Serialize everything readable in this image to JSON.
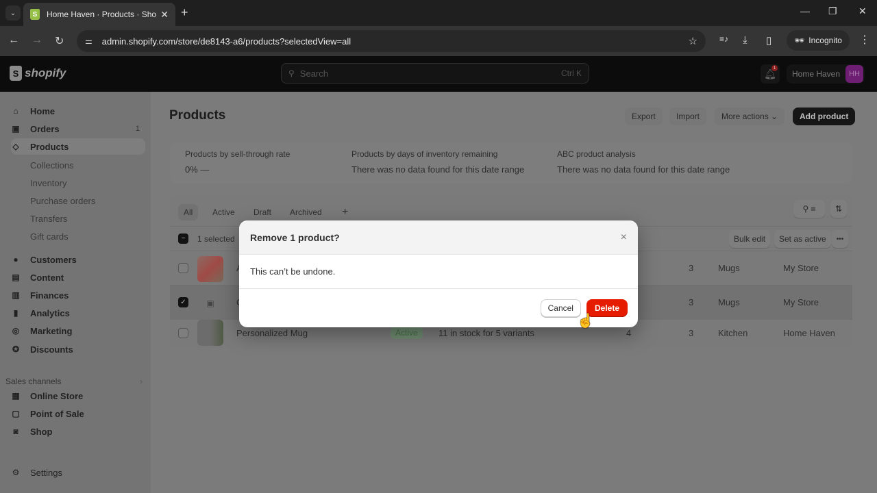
{
  "browser": {
    "tab_title": "Home Haven · Products · Shopify",
    "url": "admin.shopify.com/store/de8143-a6/products?selectedView=all",
    "incognito_label": "Incognito",
    "new_tab": "+",
    "icons": {
      "back": "←",
      "forward": "→",
      "reload": "↻",
      "star": "☆",
      "media": "≡♪",
      "download": "⤓",
      "sidepanel": "▯",
      "menu": "⋮",
      "minimize": "—",
      "restore": "❐",
      "close": "✕",
      "tab_close": "✕",
      "tabs_menu": "⌄"
    }
  },
  "topbar": {
    "logo_text": "shopify",
    "search_placeholder": "Search",
    "search_shortcut": "Ctrl K",
    "notification_count": "1",
    "store_name": "Home Haven",
    "avatar_initials": "HH"
  },
  "sidebar": {
    "items": [
      {
        "label": "Home",
        "icon": "⌂"
      },
      {
        "label": "Orders",
        "icon": "▣",
        "badge": "1"
      },
      {
        "label": "Products",
        "icon": "◇"
      },
      {
        "label": "Collections"
      },
      {
        "label": "Inventory"
      },
      {
        "label": "Purchase orders"
      },
      {
        "label": "Transfers"
      },
      {
        "label": "Gift cards"
      },
      {
        "label": "Customers",
        "icon": "●"
      },
      {
        "label": "Content",
        "icon": "▤"
      },
      {
        "label": "Finances",
        "icon": "▥"
      },
      {
        "label": "Analytics",
        "icon": "▮"
      },
      {
        "label": "Marketing",
        "icon": "◎"
      },
      {
        "label": "Discounts",
        "icon": "✪"
      }
    ],
    "sales_channels_label": "Sales channels",
    "channels": [
      {
        "label": "Online Store",
        "icon": "▦"
      },
      {
        "label": "Point of Sale",
        "icon": "▢"
      },
      {
        "label": "Shop",
        "icon": "◙"
      }
    ],
    "settings_label": "Settings",
    "settings_icon": "⚙"
  },
  "page": {
    "title": "Products",
    "actions": {
      "export": "Export",
      "import": "Import",
      "more": "More actions ⌄",
      "add": "Add product"
    },
    "metrics": [
      {
        "label": "Products by sell-through rate",
        "value": "0%  —"
      },
      {
        "label": "Products by days of inventory remaining",
        "value": "There was no data found for this date range"
      },
      {
        "label": "ABC product analysis",
        "value": "There was no data found for this date range"
      }
    ],
    "view_tabs": [
      "All",
      "Active",
      "Draft",
      "Archived",
      "+"
    ],
    "selected_count": "1 selected",
    "bulk_actions": {
      "bulk_edit": "Bulk edit",
      "set_active": "Set as active",
      "more": "•••"
    },
    "rows": [
      {
        "name": "A",
        "status": "",
        "inventory": "",
        "sales_channels": "",
        "markets": "3",
        "category": "Mugs",
        "vendor": "My Store",
        "checked": false
      },
      {
        "name": "C",
        "status": "",
        "inventory": "",
        "sales_channels": "",
        "markets": "3",
        "category": "Mugs",
        "vendor": "My Store",
        "checked": true
      },
      {
        "name": "Personalized Mug",
        "status": "Active",
        "inventory": "11 in stock for 5 variants",
        "sales_channels": "4",
        "markets": "3",
        "category": "Kitchen",
        "vendor": "Home Haven",
        "checked": false
      }
    ]
  },
  "modal": {
    "title": "Remove 1 product?",
    "body": "This can’t be undone.",
    "cancel": "Cancel",
    "delete": "Delete",
    "close_icon": "×"
  },
  "colors": {
    "danger": "#e51c00",
    "primary_dark": "#161616",
    "avatar": "#6e1f73"
  }
}
